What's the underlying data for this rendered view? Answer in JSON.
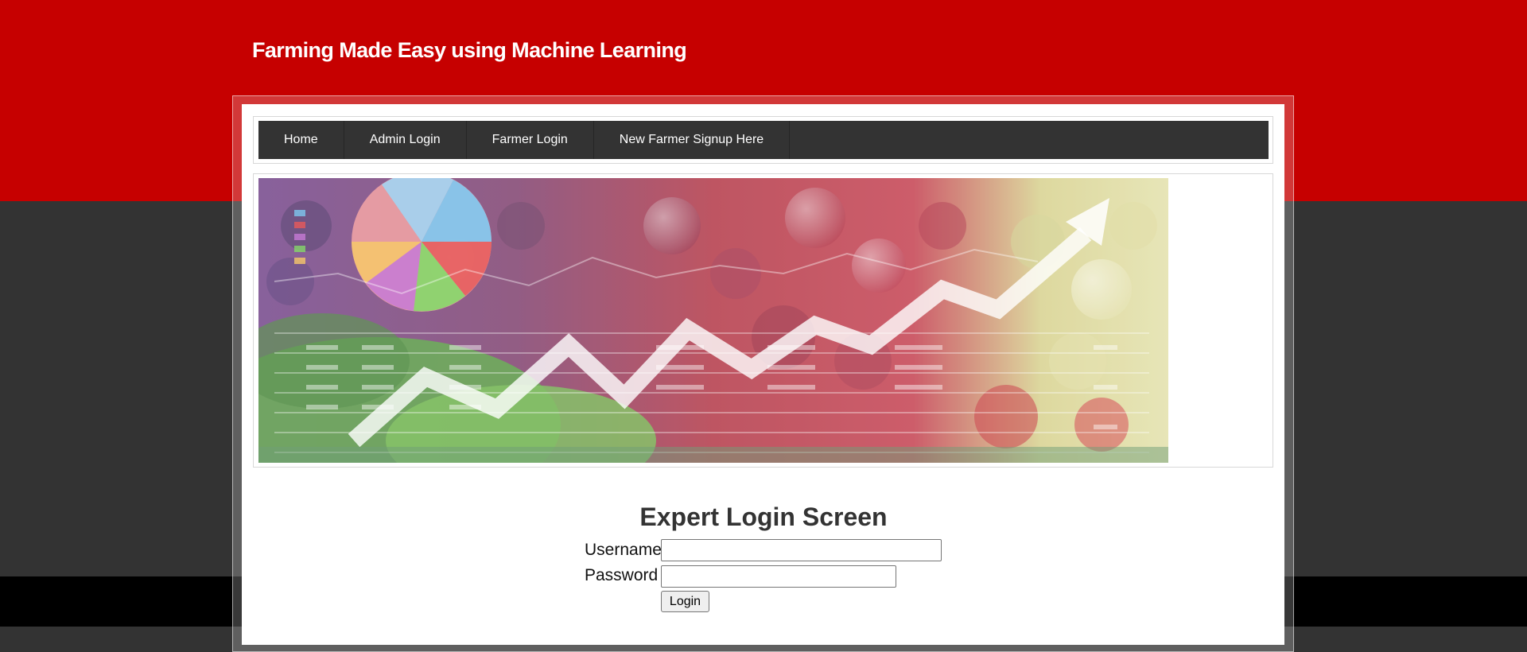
{
  "site": {
    "title": "Farming Made Easy using Machine Learning"
  },
  "nav": {
    "items": [
      {
        "label": "Home"
      },
      {
        "label": "Admin Login"
      },
      {
        "label": "Farmer Login"
      },
      {
        "label": "New Farmer Signup Here"
      }
    ]
  },
  "banner": {
    "icon": "market-growth-banner-image"
  },
  "login": {
    "title": "Expert Login Screen",
    "username_label": "Username",
    "username_value": "",
    "password_label": "Password",
    "password_value": "",
    "submit_label": "Login"
  },
  "colors": {
    "header_red": "#c60000",
    "background_dark": "#333333",
    "nav_bar": "#333333",
    "footer_black": "#000000"
  }
}
